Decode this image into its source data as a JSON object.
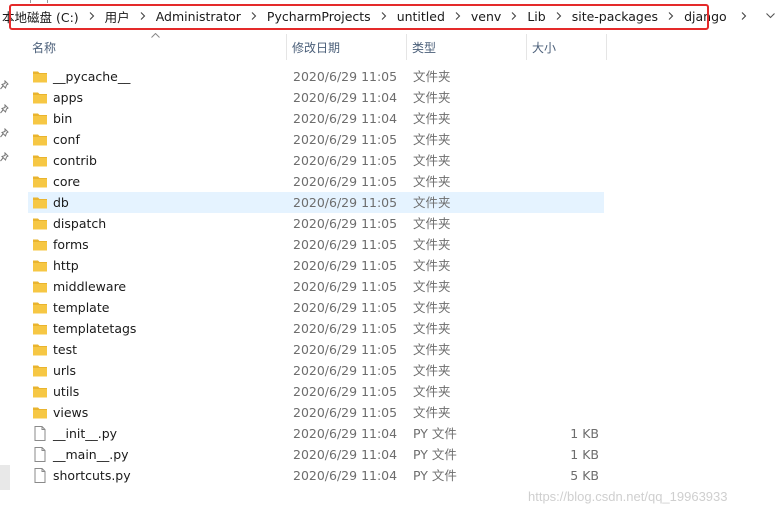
{
  "breadcrumb": [
    "本地磁盘 (C:)",
    "用户",
    "Administrator",
    "PycharmProjects",
    "untitled",
    "venv",
    "Lib",
    "site-packages",
    "django"
  ],
  "columns": {
    "name": "名称",
    "date": "修改日期",
    "type": "类型",
    "size": "大小"
  },
  "files": [
    {
      "name": "__pycache__",
      "date": "2020/6/29 11:05",
      "type": "文件夹",
      "size": "",
      "icon": "folder-icon"
    },
    {
      "name": "apps",
      "date": "2020/6/29 11:04",
      "type": "文件夹",
      "size": "",
      "icon": "folder-icon"
    },
    {
      "name": "bin",
      "date": "2020/6/29 11:04",
      "type": "文件夹",
      "size": "",
      "icon": "folder-icon"
    },
    {
      "name": "conf",
      "date": "2020/6/29 11:05",
      "type": "文件夹",
      "size": "",
      "icon": "folder-icon"
    },
    {
      "name": "contrib",
      "date": "2020/6/29 11:05",
      "type": "文件夹",
      "size": "",
      "icon": "folder-icon"
    },
    {
      "name": "core",
      "date": "2020/6/29 11:05",
      "type": "文件夹",
      "size": "",
      "icon": "folder-icon"
    },
    {
      "name": "db",
      "date": "2020/6/29 11:05",
      "type": "文件夹",
      "size": "",
      "icon": "folder-icon",
      "selected": true
    },
    {
      "name": "dispatch",
      "date": "2020/6/29 11:05",
      "type": "文件夹",
      "size": "",
      "icon": "folder-icon"
    },
    {
      "name": "forms",
      "date": "2020/6/29 11:05",
      "type": "文件夹",
      "size": "",
      "icon": "folder-icon"
    },
    {
      "name": "http",
      "date": "2020/6/29 11:05",
      "type": "文件夹",
      "size": "",
      "icon": "folder-icon"
    },
    {
      "name": "middleware",
      "date": "2020/6/29 11:05",
      "type": "文件夹",
      "size": "",
      "icon": "folder-icon"
    },
    {
      "name": "template",
      "date": "2020/6/29 11:05",
      "type": "文件夹",
      "size": "",
      "icon": "folder-icon"
    },
    {
      "name": "templatetags",
      "date": "2020/6/29 11:05",
      "type": "文件夹",
      "size": "",
      "icon": "folder-icon"
    },
    {
      "name": "test",
      "date": "2020/6/29 11:05",
      "type": "文件夹",
      "size": "",
      "icon": "folder-icon"
    },
    {
      "name": "urls",
      "date": "2020/6/29 11:05",
      "type": "文件夹",
      "size": "",
      "icon": "folder-icon"
    },
    {
      "name": "utils",
      "date": "2020/6/29 11:05",
      "type": "文件夹",
      "size": "",
      "icon": "folder-icon"
    },
    {
      "name": "views",
      "date": "2020/6/29 11:05",
      "type": "文件夹",
      "size": "",
      "icon": "folder-icon"
    },
    {
      "name": "__init__.py",
      "date": "2020/6/29 11:04",
      "type": "PY 文件",
      "size": "1 KB",
      "icon": "file-icon"
    },
    {
      "name": "__main__.py",
      "date": "2020/6/29 11:04",
      "type": "PY 文件",
      "size": "1 KB",
      "icon": "file-icon"
    },
    {
      "name": "shortcuts.py",
      "date": "2020/6/29 11:04",
      "type": "PY 文件",
      "size": "5 KB",
      "icon": "file-icon"
    }
  ],
  "watermark": "https://blog.csdn.net/qq_19963933",
  "colors": {
    "highlight_border": "#e42a2a",
    "selected_row": "#e5f3ff",
    "folder": "#f6c744",
    "header_text": "#4c607a"
  }
}
